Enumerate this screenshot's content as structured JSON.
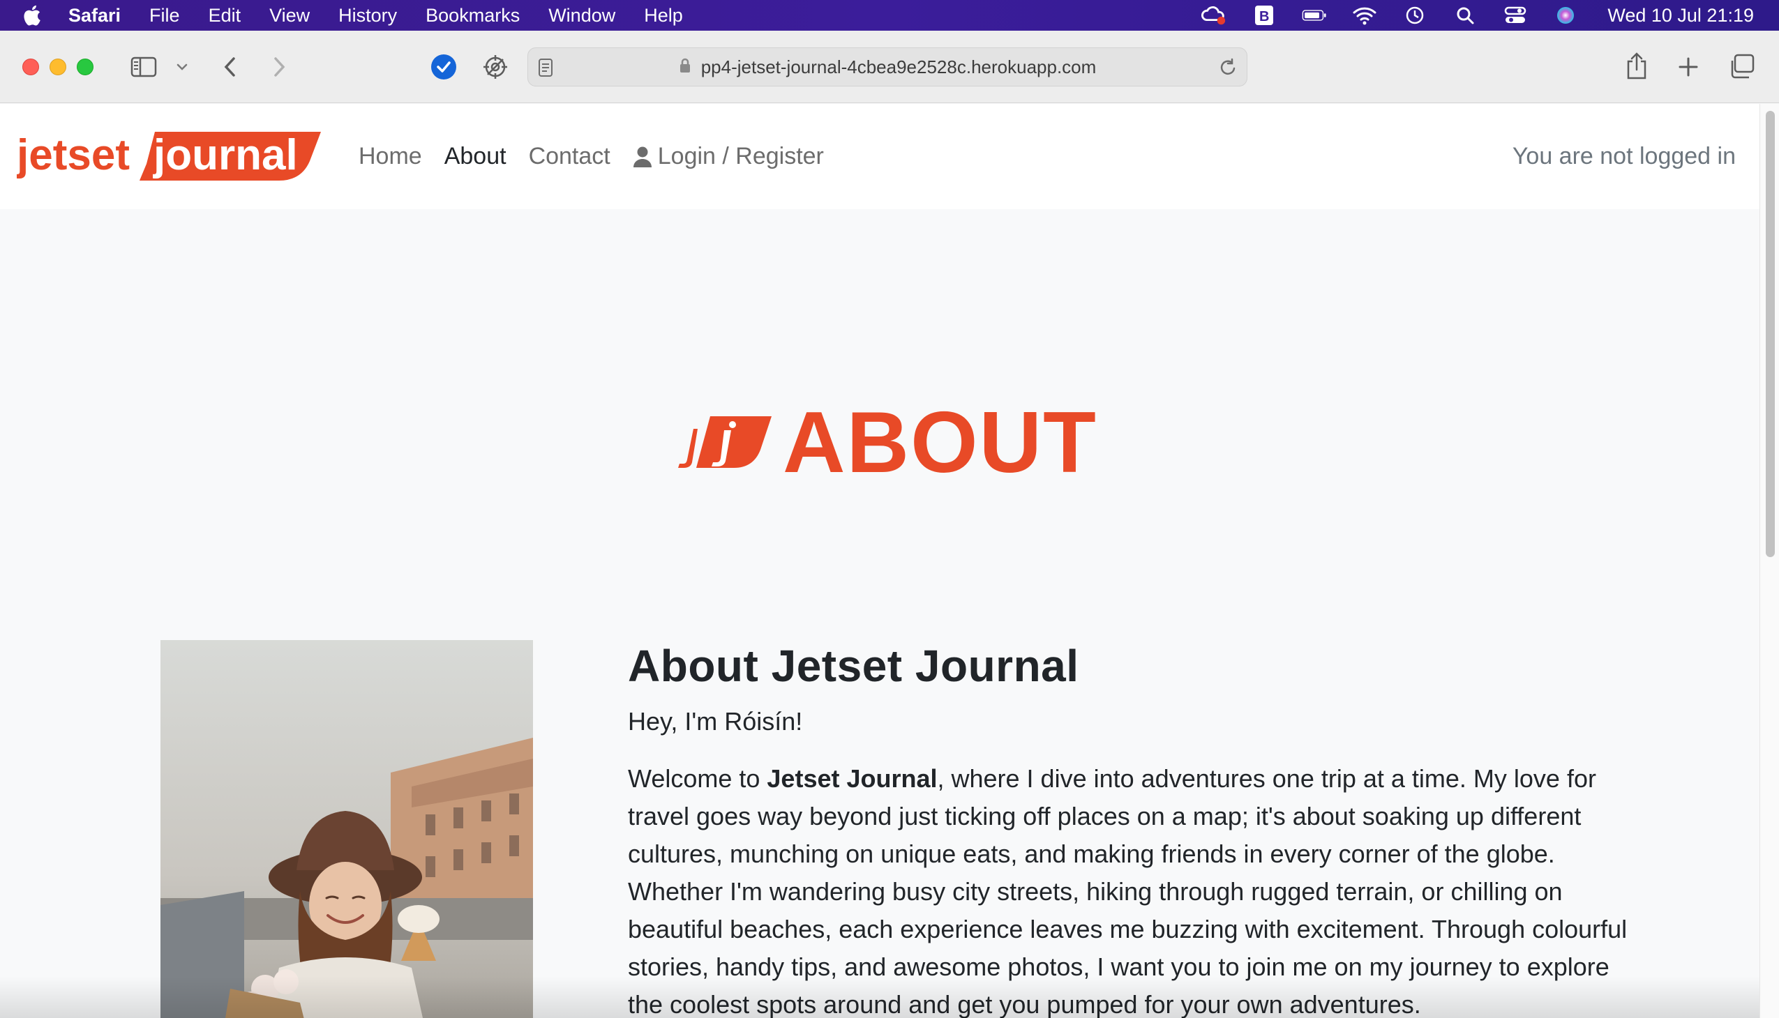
{
  "menubar": {
    "app": "Safari",
    "items": [
      "File",
      "Edit",
      "View",
      "History",
      "Bookmarks",
      "Window",
      "Help"
    ],
    "datetime": "Wed 10 Jul  21:19"
  },
  "browser": {
    "url": "pp4-jetset-journal-4cbea9e2528c.herokuapp.com"
  },
  "site": {
    "logo_text_left": "jetset",
    "logo_text_right": "journal",
    "nav": {
      "home": "Home",
      "about": "About",
      "contact": "Contact",
      "login": "Login / Register"
    },
    "login_status": "You are not logged in",
    "brand_color": "#e84a27"
  },
  "hero": {
    "title": "ABOUT"
  },
  "about": {
    "heading": "About Jetset Journal",
    "greeting": "Hey, I'm Róisín!",
    "intro_prefix": "Welcome to ",
    "intro_bold": "Jetset Journal",
    "intro_rest": ", where I dive into adventures one trip at a time. My love for travel goes way beyond just ticking off places on a map; it's about soaking up different cultures, munching on unique eats, and making friends in every corner of the globe. Whether I'm wandering busy city streets, hiking through rugged terrain, or chilling on beautiful beaches, each experience leaves me buzzing with excitement. Through colourful stories, handy tips, and awesome photos, I want you to join me on my journey to explore the coolest spots around and get you pumped for your own adventures."
  }
}
